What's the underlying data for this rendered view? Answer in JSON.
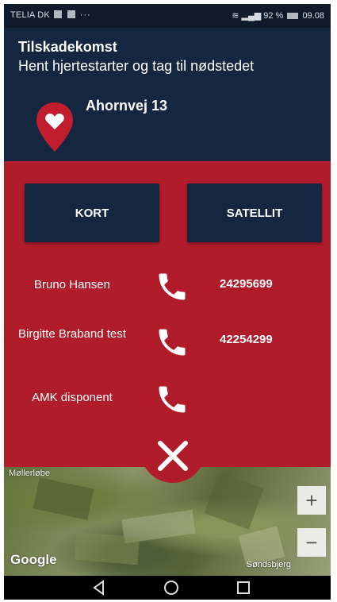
{
  "status_bar": {
    "carrier": "TELIA DK",
    "battery": "92 %",
    "time": "09.08",
    "dots": "···"
  },
  "header": {
    "title": "Tilskadekomst",
    "subtitle": "Hent hjertestarter og tag til nødstedet",
    "address": "Ahornvej 13"
  },
  "map_toggle": {
    "map_label": "KORT",
    "satellite_label": "SATELLIT"
  },
  "contacts": [
    {
      "name": "Bruno Hansen",
      "number": "24295699"
    },
    {
      "name": "Birgitte Braband test",
      "number": "42254299"
    },
    {
      "name": "AMK disponent",
      "number": ""
    }
  ],
  "map": {
    "zoom_in": "+",
    "zoom_out": "−",
    "logo": "Google",
    "place_label": "Søndsbjerg",
    "place_top_label": "Møllerløbe"
  },
  "colors": {
    "navy": "#152640",
    "red": "#b11c2a"
  },
  "icons": {
    "pin": "map-pin-heart-icon",
    "call": "phone-icon",
    "close": "close-icon"
  }
}
